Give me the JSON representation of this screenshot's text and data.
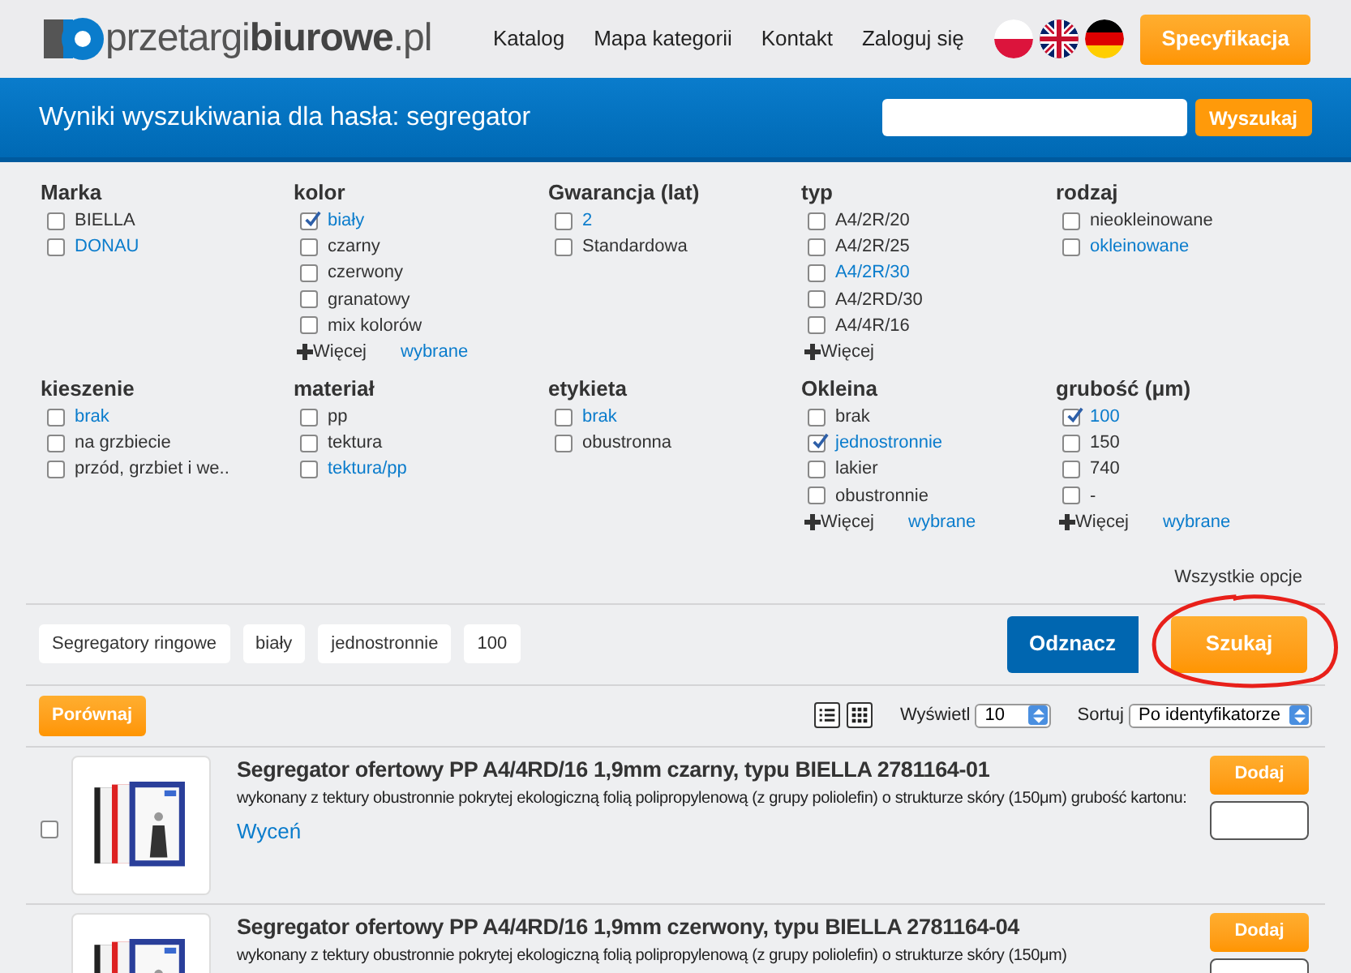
{
  "logo": {
    "part_1": "przetargi",
    "part_2": "biurowe",
    "part_3": ".pl"
  },
  "nav": [
    "Katalog",
    "Mapa kategorii",
    "Kontakt",
    "Zaloguj się"
  ],
  "languages": [
    {
      "kind": "pl",
      "selected": false
    },
    {
      "kind": "en",
      "selected": false
    },
    {
      "kind": "de",
      "selected": false
    }
  ],
  "spec_button": "Specyfikacja",
  "search_bar": {
    "title": "Wyniki wyszukiwania dla hasła: segregator",
    "button": "Wyszukaj"
  },
  "filter_rows": [
    [
      {
        "title": "Marka",
        "items": [
          {
            "label": "BIELLA",
            "checked": false,
            "highlighted": false
          },
          {
            "label": "DONAU",
            "checked": false,
            "highlighted": true
          }
        ]
      },
      {
        "title": "kolor",
        "items": [
          {
            "label": "biały",
            "checked": true,
            "highlighted": true
          },
          {
            "label": "czarny",
            "checked": false,
            "highlighted": false
          },
          {
            "label": "czerwony",
            "checked": false,
            "highlighted": false
          },
          {
            "label": "granatowy",
            "checked": false,
            "highlighted": false
          },
          {
            "label": "mix kolorów",
            "checked": false,
            "highlighted": false
          }
        ],
        "more": "Więcej",
        "chosen": "wybrane"
      },
      {
        "title": "Gwarancja (lat)",
        "items": [
          {
            "label": "2",
            "checked": false,
            "highlighted": true
          },
          {
            "label": "Standardowa",
            "checked": false,
            "highlighted": false
          }
        ]
      },
      {
        "title": "typ",
        "items": [
          {
            "label": "A4/2R/20",
            "checked": false,
            "highlighted": false
          },
          {
            "label": "A4/2R/25",
            "checked": false,
            "highlighted": false
          },
          {
            "label": "A4/2R/30",
            "checked": false,
            "highlighted": true
          },
          {
            "label": "A4/2RD/30",
            "checked": false,
            "highlighted": false
          },
          {
            "label": "A4/4R/16",
            "checked": false,
            "highlighted": false
          }
        ],
        "more": "Więcej"
      },
      {
        "title": "rodzaj",
        "items": [
          {
            "label": "nieokleinowane",
            "checked": false,
            "highlighted": false
          },
          {
            "label": "okleinowane",
            "checked": false,
            "highlighted": true
          }
        ]
      }
    ],
    [
      {
        "title": "kieszenie",
        "items": [
          {
            "label": "brak",
            "checked": false,
            "highlighted": true
          },
          {
            "label": "na grzbiecie",
            "checked": false,
            "highlighted": false
          },
          {
            "label": "przód, grzbiet i we..",
            "checked": false,
            "highlighted": false
          }
        ]
      },
      {
        "title": "materiał",
        "items": [
          {
            "label": "pp",
            "checked": false,
            "highlighted": false
          },
          {
            "label": "tektura",
            "checked": false,
            "highlighted": false
          },
          {
            "label": "tektura/pp",
            "checked": false,
            "highlighted": true
          }
        ]
      },
      {
        "title": "etykieta",
        "items": [
          {
            "label": "brak",
            "checked": false,
            "highlighted": true
          },
          {
            "label": "obustronna",
            "checked": false,
            "highlighted": false
          }
        ]
      },
      {
        "title": "Okleina",
        "items": [
          {
            "label": "brak",
            "checked": false,
            "highlighted": false
          },
          {
            "label": "jednostronnie",
            "checked": true,
            "highlighted": true
          },
          {
            "label": "lakier",
            "checked": false,
            "highlighted": false
          },
          {
            "label": "obustronnie",
            "checked": false,
            "highlighted": false
          }
        ],
        "more": "Więcej",
        "chosen": "wybrane"
      },
      {
        "title": "grubość (μm)",
        "items": [
          {
            "label": "100",
            "checked": true,
            "highlighted": true
          },
          {
            "label": "150",
            "checked": false,
            "highlighted": false
          },
          {
            "label": "740",
            "checked": false,
            "highlighted": false
          },
          {
            "label": "-",
            "checked": false,
            "highlighted": false
          }
        ],
        "more": "Więcej",
        "chosen": "wybrane"
      }
    ]
  ],
  "all_options": "Wszystkie opcje",
  "selected_tags": [
    "Segregatory ringowe",
    "biały",
    "jednostronnie",
    "100"
  ],
  "clear_button": "Odznacz",
  "search_button": "Szukaj",
  "compare_button": "Porównaj",
  "view_modes": [
    {
      "kind": "list",
      "selected": false
    },
    {
      "kind": "grid",
      "selected": false
    }
  ],
  "show_label": "Wyświetl",
  "show_value": "10",
  "sort_label": "Sortuj",
  "sort_value": "Po identyfikatorze",
  "products": [
    {
      "title": "Segregator ofertowy PP A4/4RD/16 1,9mm czarny, typu BIELLA 2781164-01",
      "description": "wykonany z tektury obustronnie pokrytej ekologiczną folią polipropylenową (z grupy poliolefin) o strukturze skóry (150μm) grubość kartonu:",
      "price_link": "Wyceń",
      "add_button": "Dodaj",
      "checked": false
    },
    {
      "title": "Segregator ofertowy PP A4/4RD/16 1,9mm czerwony, typu BIELLA 2781164-04",
      "description": "wykonany z tektury obustronnie pokrytej ekologiczną folią polipropylenową (z grupy poliolefin) o strukturze skóry (150μm)",
      "add_button": "Dodaj"
    }
  ]
}
